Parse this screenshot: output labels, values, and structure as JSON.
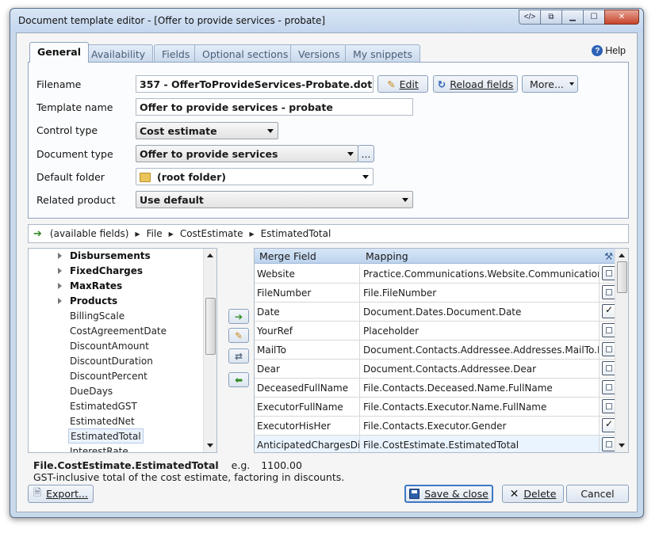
{
  "window": {
    "title": "Document template editor - [Offer to provide services - probate]"
  },
  "tabs": [
    {
      "label": "General",
      "active": true
    },
    {
      "label": "Availability"
    },
    {
      "label": "Fields"
    },
    {
      "label": "Optional sections"
    },
    {
      "label": "Versions"
    },
    {
      "label": "My snippets"
    }
  ],
  "help_label": "Help",
  "form": {
    "filename_label": "Filename",
    "filename_value": "357 - OfferToProvideServices-Probate.dot",
    "edit_button": "Edit",
    "reload_button": "Reload fields",
    "more_button": "More...",
    "template_name_label": "Template name",
    "template_name_value": "Offer to provide services - probate",
    "control_type_label": "Control type",
    "control_type_value": "Cost estimate",
    "document_type_label": "Document type",
    "document_type_value": "Offer to provide services",
    "ellipsis_button": "...",
    "default_folder_label": "Default folder",
    "default_folder_value": "(root folder)",
    "related_product_label": "Related product",
    "related_product_value": "Use default"
  },
  "breadcrumb": [
    "(available fields)",
    "File",
    "CostEstimate",
    "EstimatedTotal"
  ],
  "tree": {
    "items": [
      {
        "label": "Disbursements",
        "bold": true,
        "expandable": true
      },
      {
        "label": "FixedCharges",
        "bold": true,
        "expandable": true
      },
      {
        "label": "MaxRates",
        "bold": true,
        "expandable": true
      },
      {
        "label": "Products",
        "bold": true,
        "expandable": true
      },
      {
        "label": "BillingScale"
      },
      {
        "label": "CostAgreementDate"
      },
      {
        "label": "DiscountAmount"
      },
      {
        "label": "DiscountDuration"
      },
      {
        "label": "DiscountPercent"
      },
      {
        "label": "DueDays"
      },
      {
        "label": "EstimatedGST"
      },
      {
        "label": "EstimatedNet"
      },
      {
        "label": "EstimatedTotal",
        "selected": true
      },
      {
        "label": "InterestRate"
      }
    ]
  },
  "grid": {
    "headers": {
      "merge_field": "Merge Field",
      "mapping": "Mapping"
    },
    "rows": [
      {
        "field": "Website",
        "mapping": "Practice.Communications.Website.Communication",
        "checked": false
      },
      {
        "field": "FileNumber",
        "mapping": "File.FileNumber",
        "checked": false
      },
      {
        "field": "Date",
        "mapping": "Document.Dates.Document.Date",
        "checked": true
      },
      {
        "field": "YourRef",
        "mapping": "Placeholder",
        "checked": false
      },
      {
        "field": "MailTo",
        "mapping": "Document.Contacts.Addressee.Addresses.MailTo.Format",
        "checked": false
      },
      {
        "field": "Dear",
        "mapping": "Document.Contacts.Addressee.Dear",
        "checked": false
      },
      {
        "field": "DeceasedFullName",
        "mapping": "File.Contacts.Deceased.Name.FullName",
        "checked": false
      },
      {
        "field": "ExecutorFullName",
        "mapping": "File.Contacts.Executor.Name.FullName",
        "checked": false
      },
      {
        "field": "ExecutorHisHer",
        "mapping": "File.Contacts.Executor.Gender",
        "checked": true
      },
      {
        "field": "AnticipatedChargesDisb",
        "mapping": "File.CostEstimate.EstimatedTotal",
        "checked": false,
        "current": true
      }
    ]
  },
  "description": {
    "path": "File.CostEstimate.EstimatedTotal",
    "eg_label": "e.g.",
    "eg_value": "1100.00",
    "text": "GST-inclusive total of the cost estimate, factoring in discounts."
  },
  "buttons": {
    "export": "Export...",
    "save_close": "Save & close",
    "delete": "Delete",
    "cancel": "Cancel"
  }
}
